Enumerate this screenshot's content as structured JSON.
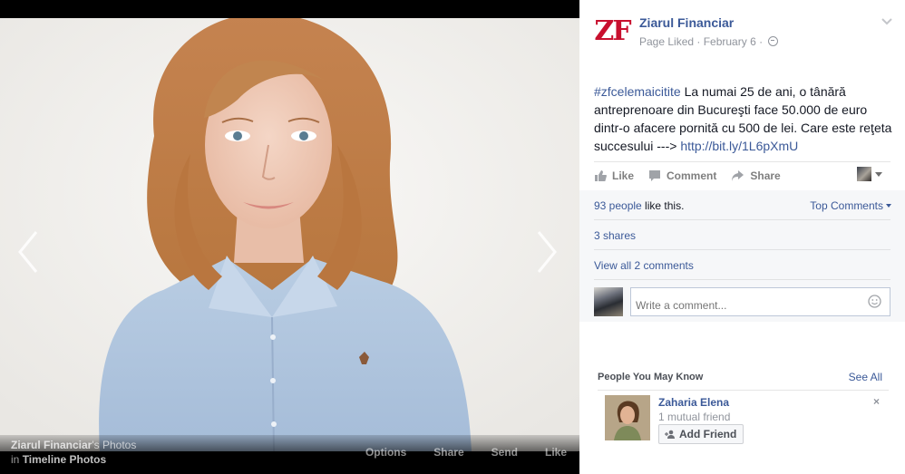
{
  "photo_viewer": {
    "owner_name": "Ziarul Financiar",
    "owner_suffix": "'s Photos",
    "album_prefix": "in",
    "album_name": "Timeline Photos",
    "actions": [
      "Options",
      "Share",
      "Send",
      "Like"
    ]
  },
  "post": {
    "page_name": "Ziarul Financiar",
    "logo_text": "ZF",
    "meta": "Page Liked · February 6 ·",
    "hashtag": "#zfcelemaicitite",
    "body": " La numai 25 de ani, o tânără antreprenoare din Bucureşti face 50.000 de euro dintr-o afacere pornită cu 500 de lei. Care este reţeta succesului ---> ",
    "link": "http://bit.ly/1L6pXmU"
  },
  "actions": {
    "like": "Like",
    "comment": "Comment",
    "share": "Share"
  },
  "ufi": {
    "likes_count": "93 people",
    "likes_suffix": " like this.",
    "top_comments": "Top Comments",
    "shares": "3 shares",
    "view_comments": "View all 2 comments",
    "comment_placeholder": "Write a comment..."
  },
  "pymk": {
    "title": "People You May Know",
    "see_all": "See All",
    "person": {
      "name": "Zaharia Elena",
      "mutual": "1 mutual friend",
      "add_label": "Add Friend",
      "close": "×"
    }
  },
  "colors": {
    "link_blue": "#3b5998",
    "brand_red": "#c8102e",
    "muted": "#90949c"
  }
}
